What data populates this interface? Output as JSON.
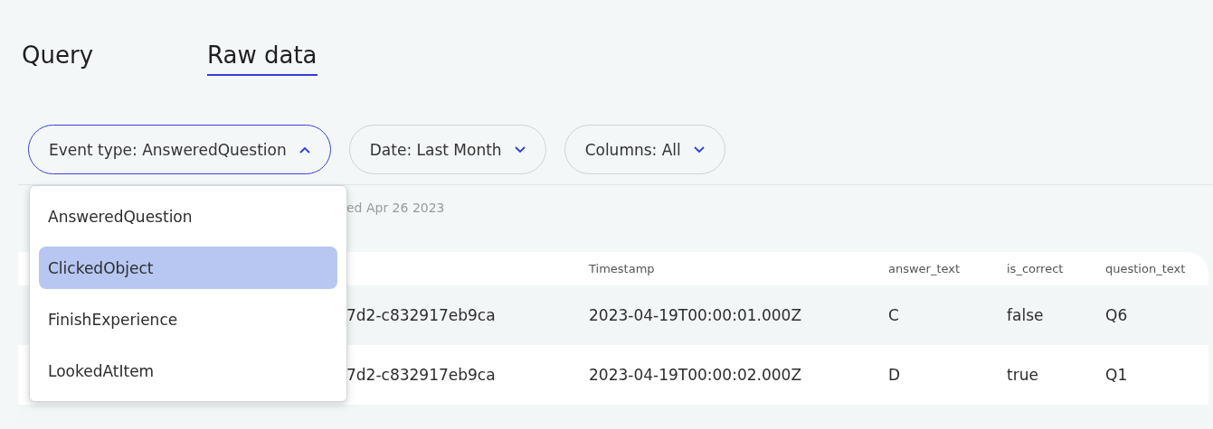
{
  "tabs": [
    {
      "label": "Query",
      "selected": false
    },
    {
      "label": "Raw data",
      "selected": true
    }
  ],
  "filters": [
    {
      "label": "Event type: AnsweredQuestion",
      "expanded": true
    },
    {
      "label": "Date: Last Month",
      "expanded": false
    },
    {
      "label": "Columns: All",
      "expanded": false
    }
  ],
  "dropdown": {
    "options": [
      {
        "label": "AnsweredQuestion",
        "selected": false
      },
      {
        "label": "ClickedObject",
        "selected": true
      },
      {
        "label": "FinishExperience",
        "selected": false
      },
      {
        "label": "LookedAtItem",
        "selected": false
      }
    ]
  },
  "summary": "ed Apr 26 2023",
  "table": {
    "columns": [
      "",
      "Timestamp",
      "answer_text",
      "is_correct",
      "question_text"
    ],
    "rows": [
      [
        "7d2-c832917eb9ca",
        "2023-04-19T00:00:01.000Z",
        "C",
        "false",
        "Q6"
      ],
      [
        "7d2-c832917eb9ca",
        "2023-04-19T00:00:02.000Z",
        "D",
        "true",
        "Q1"
      ]
    ]
  }
}
